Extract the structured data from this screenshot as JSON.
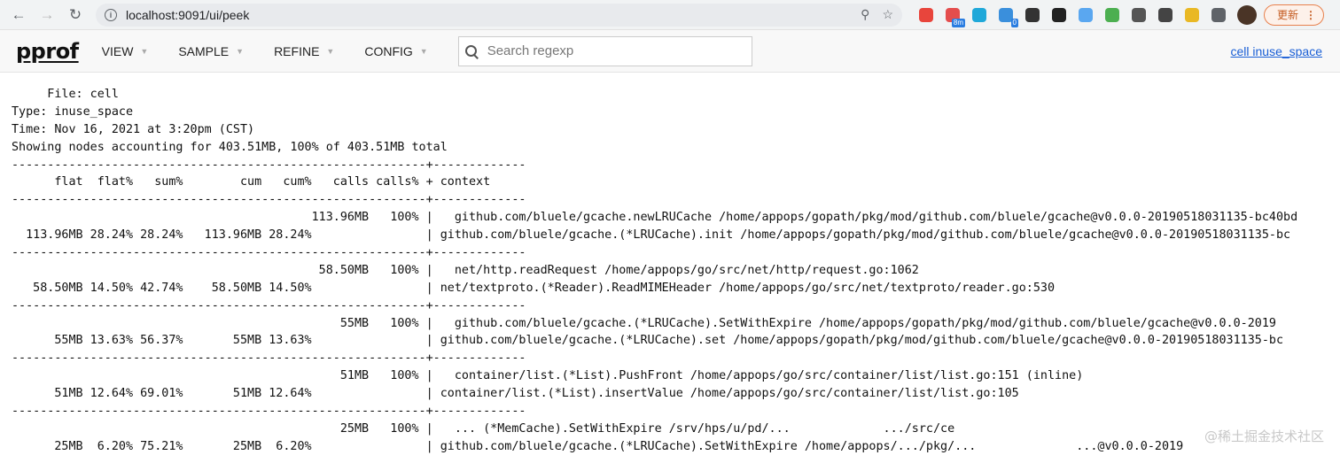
{
  "browser": {
    "url": "localhost:9091/ui/peek",
    "update_label": "更新",
    "extensions": [
      {
        "name": "chrome-color-icon",
        "color": "#e8453c"
      },
      {
        "name": "time-tracker-icon",
        "color": "#e44d4d",
        "badge": "8m",
        "badge_color": "#2a7de1"
      },
      {
        "name": "filter-icon",
        "color": "#1fa8d9"
      },
      {
        "name": "extension-badge-icon",
        "color": "#3a8fdc",
        "badge": "0",
        "badge_color": "#2a7de1"
      },
      {
        "name": "timer-icon",
        "color": "#333333"
      },
      {
        "name": "github-icon",
        "color": "#222222"
      },
      {
        "name": "compass-icon",
        "color": "#5aa7f0"
      },
      {
        "name": "house-icon",
        "color": "#4caf50"
      },
      {
        "name": "qr-code-icon",
        "color": "#555555"
      },
      {
        "name": "play-icon",
        "color": "#444444"
      },
      {
        "name": "duck-icon",
        "color": "#e9b824"
      },
      {
        "name": "puzzle-icon",
        "color": "#5f6368"
      }
    ]
  },
  "header": {
    "logo": "pprof",
    "menus": [
      "VIEW",
      "SAMPLE",
      "REFINE",
      "CONFIG"
    ],
    "search_placeholder": "Search regexp",
    "title_link": "cell inuse_space"
  },
  "report": {
    "lines": [
      "     File: cell",
      "Type: inuse_space",
      "Time: Nov 16, 2021 at 3:20pm (CST)",
      "Showing nodes accounting for 403.51MB, 100% of 403.51MB total",
      "----------------------------------------------------------+-------------",
      "      flat  flat%   sum%        cum   cum%   calls calls% + context",
      "----------------------------------------------------------+-------------",
      "                                          113.96MB   100% |   github.com/bluele/gcache.newLRUCache /home/appops/gopath/pkg/mod/github.com/bluele/gcache@v0.0.0-20190518031135-bc40bd",
      "  113.96MB 28.24% 28.24%   113.96MB 28.24%                | github.com/bluele/gcache.(*LRUCache).init /home/appops/gopath/pkg/mod/github.com/bluele/gcache@v0.0.0-20190518031135-bc",
      "----------------------------------------------------------+-------------",
      "                                           58.50MB   100% |   net/http.readRequest /home/appops/go/src/net/http/request.go:1062",
      "   58.50MB 14.50% 42.74%    58.50MB 14.50%                | net/textproto.(*Reader).ReadMIMEHeader /home/appops/go/src/net/textproto/reader.go:530",
      "----------------------------------------------------------+-------------",
      "                                              55MB   100% |   github.com/bluele/gcache.(*LRUCache).SetWithExpire /home/appops/gopath/pkg/mod/github.com/bluele/gcache@v0.0.0-2019",
      "      55MB 13.63% 56.37%       55MB 13.63%                | github.com/bluele/gcache.(*LRUCache).set /home/appops/gopath/pkg/mod/github.com/bluele/gcache@v0.0.0-20190518031135-bc",
      "----------------------------------------------------------+-------------",
      "                                              51MB   100% |   container/list.(*List).PushFront /home/appops/go/src/container/list/list.go:151 (inline)",
      "      51MB 12.64% 69.01%       51MB 12.64%                | container/list.(*List).insertValue /home/appops/go/src/container/list/list.go:105",
      "----------------------------------------------------------+-------------",
      "                                              25MB   100% |   ... (*MemCache).SetWithExpire /srv/hps/u/pd/...             .../src/ce",
      "      25MB  6.20% 75.21%       25MB  6.20%                | github.com/bluele/gcache.(*LRUCache).SetWithExpire /home/appops/.../pkg/...              ...@v0.0.0-2019"
    ]
  },
  "watermark": "@稀土掘金技术社区"
}
